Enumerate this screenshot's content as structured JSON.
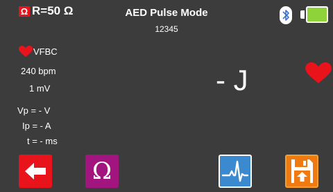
{
  "header": {
    "resistance_badge": "Ω",
    "resistance_text": "R=50 Ω",
    "title": "AED Pulse Mode",
    "serial": "12345",
    "bluetooth_icon": "bluetooth-icon",
    "battery_icon": "battery-icon",
    "battery_level": 1.0
  },
  "readings": {
    "rhythm": "VFBC",
    "rate": "240 bpm",
    "amplitude": "1 mV",
    "vp": "Vp = - V",
    "ip": "Ip = - A",
    "t": "t = - ms",
    "energy": "- J"
  },
  "colors": {
    "background": "#3c3c3c",
    "red": "#e8131b",
    "magenta": "#a3157e",
    "blue": "#3b8ad0",
    "orange": "#f07a12",
    "battery_green": "#8ed33a"
  },
  "toolbar": {
    "back_icon": "back-arrow-icon",
    "ohm_label": "Ω",
    "waveform_icon": "ecg-waveform-icon",
    "save_icon": "save-icon"
  }
}
